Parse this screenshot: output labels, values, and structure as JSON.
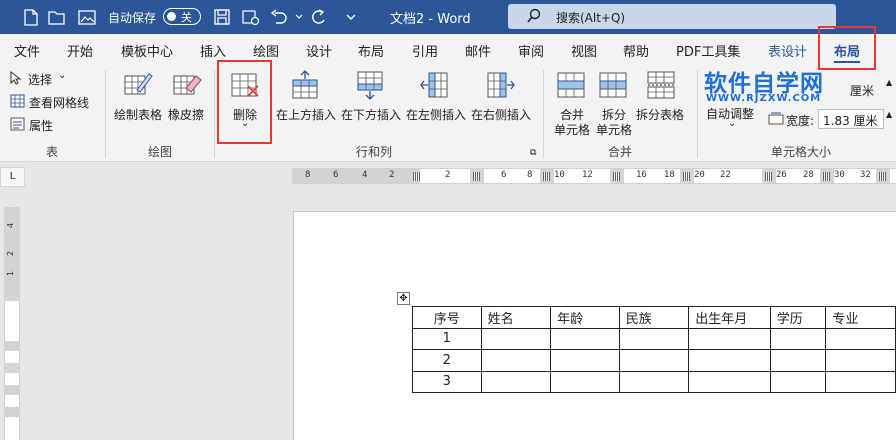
{
  "titlebar": {
    "autosave_label": "自动保存",
    "autosave_state": "关",
    "doc_title": "文档2  -  Word",
    "search_label": "搜索(Alt+Q)"
  },
  "tabs": [
    "文件",
    "开始",
    "模板中心",
    "插入",
    "绘图",
    "设计",
    "布局",
    "引用",
    "邮件",
    "审阅",
    "视图",
    "帮助",
    "PDF工具集",
    "表设计",
    "布局"
  ],
  "ribbon": {
    "table_group": {
      "select": "选择",
      "gridlines": "查看网格线",
      "properties": "属性",
      "label": "表"
    },
    "draw_group": {
      "draw_table": "绘制表格",
      "eraser": "橡皮擦",
      "label": "绘图"
    },
    "rowcol_group": {
      "delete": "删除",
      "insert_above": "在上方插入",
      "insert_below": "在下方插入",
      "insert_left": "在左侧插入",
      "insert_right": "在右侧插入",
      "label": "行和列"
    },
    "merge_group": {
      "merge_cells_1": "合并",
      "merge_cells_2": "单元格",
      "split_cells_1": "拆分",
      "split_cells_2": "单元格",
      "split_table": "拆分表格",
      "label": "合并"
    },
    "cellsize_group": {
      "autofit": "自动调整",
      "height_unit": "厘米",
      "width_label": "宽度:",
      "width_value": "1.83 厘米",
      "label": "单元格大小"
    }
  },
  "watermark": {
    "big": "软件自学网",
    "small": "WWW.RJZXW.COM"
  },
  "ruler": {
    "corner": "L",
    "numbers": [
      "8",
      "6",
      "4",
      "2",
      "2",
      "6",
      "8",
      "10",
      "12",
      "16",
      "18",
      "20",
      "22",
      "26",
      "28",
      "30",
      "32",
      "34"
    ],
    "vnumbers": [
      "4",
      "2",
      "1"
    ]
  },
  "table": {
    "rows": [
      [
        "序号",
        "姓名",
        "年龄",
        "民族",
        "出生年月",
        "学历",
        "专业"
      ],
      [
        "1",
        "",
        "",
        "",
        "",
        "",
        ""
      ],
      [
        "2",
        "",
        "",
        "",
        "",
        "",
        ""
      ],
      [
        "3",
        "",
        "",
        "",
        "",
        "",
        ""
      ]
    ]
  },
  "colors": {
    "titlebar": "#2b579a",
    "highlight": "#e53935",
    "watermark": "#1e6fd9"
  }
}
